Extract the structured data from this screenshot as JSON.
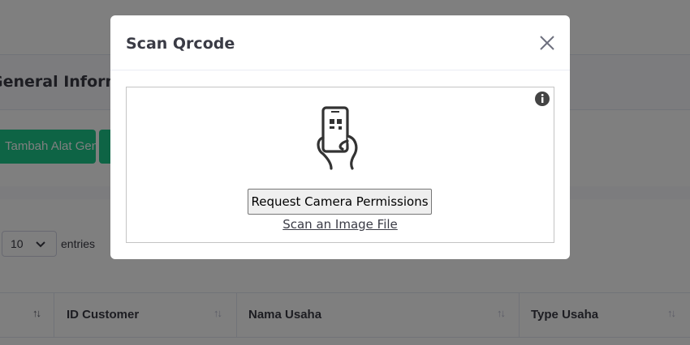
{
  "background": {
    "card_title": "General Information",
    "add_button_label": "Tambah Alat General Baru",
    "length_value": "10",
    "entries_label": "entries",
    "table": {
      "columns": [
        "ID Customer",
        "Nama Usaha",
        "Type Usaha"
      ]
    }
  },
  "modal": {
    "title": "Scan Qrcode",
    "request_permission_label": "Request Camera Permissions",
    "scan_image_label": "Scan an Image File"
  },
  "icons": {
    "close": "close-icon",
    "info": "info-icon",
    "phone": "phone-qr-icon",
    "chevron": "chevron-down-icon",
    "sort": "sort-icon"
  },
  "colors": {
    "success": "#1cc88a",
    "backdrop": "rgba(0,0,0,0.5)"
  }
}
